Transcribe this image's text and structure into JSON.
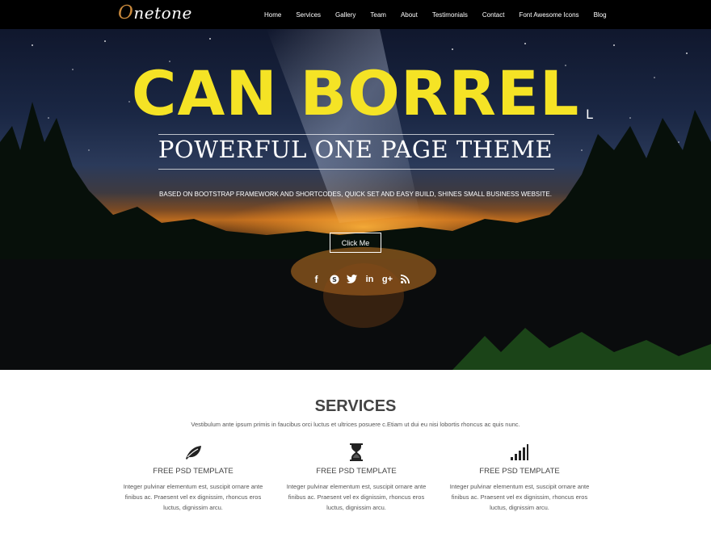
{
  "nav": {
    "logo_first": "O",
    "logo_rest": "netone",
    "items": [
      "Home",
      "Services",
      "Gallery",
      "Team",
      "About",
      "Testimonials",
      "Contact",
      "Font Awesome Icons",
      "Blog"
    ]
  },
  "hero": {
    "headline": "CAN BORREL",
    "headline_tail": "L",
    "subtitle": "POWERFUL ONE PAGE THEME",
    "tagline": "BASED ON BOOTSTRAP FRAMEWORK AND SHORTCODES, QUICK SET AND EASY BUILD, SHINES SMALL BUSINESS WEBSITE.",
    "button_label": "Click Me",
    "social": [
      {
        "icon": "facebook-icon",
        "glyph": "f"
      },
      {
        "icon": "skype-icon",
        "glyph": "S"
      },
      {
        "icon": "twitter-icon",
        "glyph": "t"
      },
      {
        "icon": "linkedin-icon",
        "glyph": "in"
      },
      {
        "icon": "google-plus-icon",
        "glyph": "g+"
      },
      {
        "icon": "rss-icon",
        "glyph": "rss"
      }
    ],
    "headline_color": "#f5e325"
  },
  "services": {
    "title": "SERVICES",
    "description": "Vestibulum ante ipsum primis in faucibus orci luctus et ultrices posuere c.Etiam ut dui eu nisi lobortis rhoncus ac quis nunc.",
    "items": [
      {
        "icon": "leaf-icon",
        "title": "FREE PSD TEMPLATE",
        "text": "Integer pulvinar elementum est, suscipit ornare ante finibus ac. Praesent vel ex dignissim, rhoncus eros luctus, dignissim arcu."
      },
      {
        "icon": "hourglass-icon",
        "title": "FREE PSD TEMPLATE",
        "text": "Integer pulvinar elementum est, suscipit ornare ante finibus ac. Praesent vel ex dignissim, rhoncus eros luctus, dignissim arcu."
      },
      {
        "icon": "signal-icon",
        "title": "FREE PSD TEMPLATE",
        "text": "Integer pulvinar elementum est, suscipit ornare ante finibus ac. Praesent vel ex dignissim, rhoncus eros luctus, dignissim arcu."
      }
    ]
  }
}
